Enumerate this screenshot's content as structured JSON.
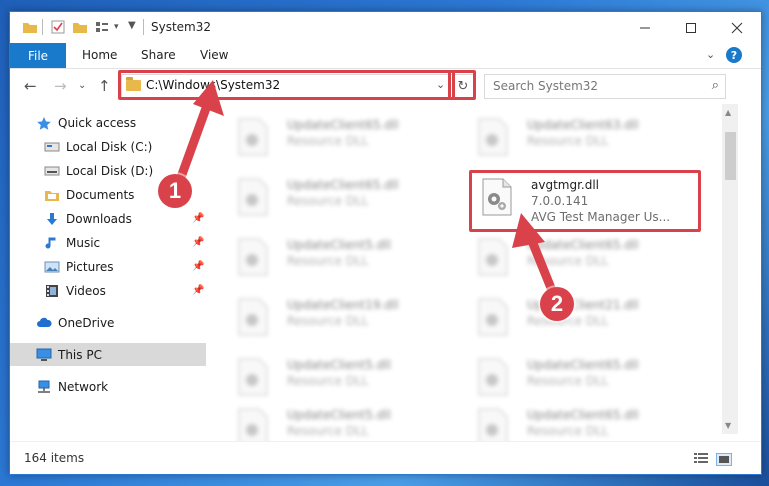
{
  "window": {
    "title": "System32"
  },
  "ribbon": {
    "file": "File",
    "tabs": [
      "Home",
      "Share",
      "View"
    ]
  },
  "navigation": {
    "address": "C:\\Windows\\System32",
    "search_placeholder": "Search System32"
  },
  "sidebar": {
    "items": [
      {
        "label": "Quick access",
        "icon": "star-icon"
      },
      {
        "label": "Local Disk (C:)",
        "icon": "drive-icon"
      },
      {
        "label": "Local Disk (D:)",
        "icon": "drive-icon"
      },
      {
        "label": "Documents",
        "icon": "documents-icon"
      },
      {
        "label": "Downloads",
        "icon": "download-icon"
      },
      {
        "label": "Music",
        "icon": "music-icon"
      },
      {
        "label": "Pictures",
        "icon": "pictures-icon"
      },
      {
        "label": "Videos",
        "icon": "videos-icon"
      },
      {
        "label": "OneDrive",
        "icon": "cloud-icon"
      },
      {
        "label": "This PC",
        "icon": "computer-icon"
      },
      {
        "label": "Network",
        "icon": "network-icon"
      }
    ]
  },
  "files": {
    "left": [
      {
        "name": "UpdateClient65.dll",
        "desc": "Resource DLL"
      },
      {
        "name": "UpdateClient65.dll",
        "desc": "Resource DLL"
      },
      {
        "name": "UpdateClient5.dll",
        "desc": "Resource DLL"
      },
      {
        "name": "UpdateClient19.dll",
        "desc": "Resource DLL"
      },
      {
        "name": "UpdateClient5.dll",
        "desc": "Resource DLL"
      },
      {
        "name": "UpdateClient5.dll",
        "desc": "Resource DLL"
      }
    ],
    "right": [
      {
        "name": "UpdateClient63.dll",
        "desc": "Resource DLL"
      },
      {
        "name": "UpdateClient65.dll",
        "desc": "Resource DLL"
      },
      {
        "name": "UpdateClient21.dll",
        "desc": "Resource DLL"
      },
      {
        "name": "UpdateClient65.dll",
        "desc": "Resource DLL"
      },
      {
        "name": "UpdateClient65.dll",
        "desc": "Resource DLL"
      }
    ],
    "highlighted": {
      "name": "avgtmgr.dll",
      "version": "7.0.0.141",
      "desc": "AVG Test Manager Us..."
    }
  },
  "status": {
    "items": "164 items"
  },
  "annotations": {
    "step1": "1",
    "step2": "2"
  },
  "colors": {
    "accent": "#1979ca",
    "annotation": "#d9424b"
  }
}
